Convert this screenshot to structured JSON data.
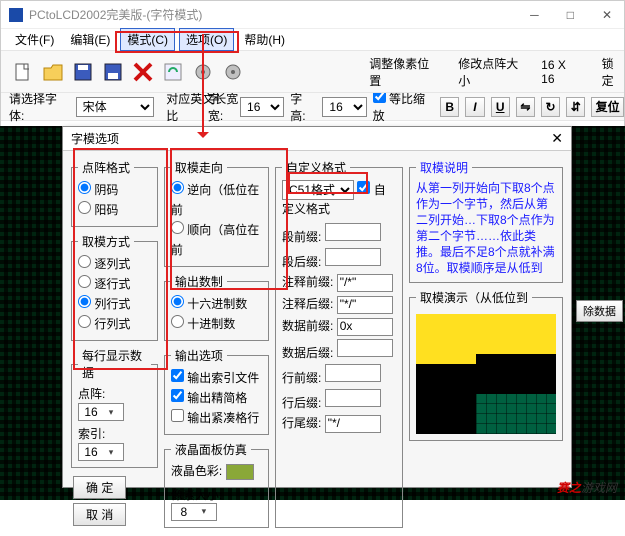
{
  "window": {
    "title": "PCtoLCD2002完美版-(字符模式)",
    "controls": {
      "min": "─",
      "max": "□",
      "close": "✕"
    }
  },
  "menu": {
    "file": "文件(F)",
    "edit": "编辑(E)",
    "mode": "模式(C)",
    "options": "选项(O)",
    "help": "帮助(H)"
  },
  "toolbar": {
    "adjust_label": "调整像素位置",
    "modify_label": "修改点阵大小",
    "size_text": "16 X 16",
    "lock_label": "锁定"
  },
  "row2": {
    "pick_font": "请选择字体:",
    "font_value": "宋体",
    "en_ratio": "对应英文长宽比",
    "width_label": "字宽:",
    "width_value": "16",
    "height_label": "字高:",
    "height_value": "16",
    "scale_label": "等比缩放",
    "restore_label": "复位"
  },
  "dialog": {
    "title": "字模选项",
    "close": "✕",
    "dot_fmt": {
      "legend": "点阵格式",
      "yin": "阴码",
      "yang": "阳码"
    },
    "scan_mode": {
      "legend": "取模方式",
      "col": "逐列式",
      "row": "逐行式",
      "colrow": "列行式",
      "rowcol": "行列式"
    },
    "row_disp": {
      "legend": "每行显示数据",
      "dot_label": "点阵:",
      "dot_val": "16",
      "idx_label": "索引:",
      "idx_val": "16"
    },
    "direction": {
      "legend": "取模走向",
      "rev": "逆向（低位在前",
      "fwd": "顺向（高位在前"
    },
    "radix": {
      "legend": "输出数制",
      "hex": "十六进制数",
      "dec": "十进制数"
    },
    "output": {
      "legend": "输出选项",
      "idxfile": "输出索引文件",
      "compact": "输出精简格",
      "tight": "输出紧凑格行"
    },
    "lcd": {
      "legend": "液晶面板仿真",
      "color_label": "液晶色彩:",
      "px_label": "像素大小:",
      "px_val": "8"
    },
    "custom": {
      "legend": "自定义格式",
      "fmt_value": "C51格式",
      "chk_label": "自定义格式",
      "seg_pre": "段前缀:",
      "seg_suf": "段后缀:",
      "cmt_pre": "注释前缀:",
      "cmt_pre_v": "\"/*\"",
      "cmt_suf": "注释后缀:",
      "cmt_suf_v": "\"*/\"",
      "dat_pre": "数据前缀:",
      "dat_pre_v": "0x",
      "dat_suf": "数据后缀:",
      "ln_pre": "行前缀:",
      "ln_suf": "行后缀:",
      "lntail": "行尾缀:",
      "lntail_v": "\"*/"
    },
    "desc": {
      "legend": "取模说明",
      "body": "从第一列开始向下取8个点作为一个字节，然后从第二列开始…下取8个点作为第二个字节……依此类推。最后不足8个点就补满8位。取模顺序是从低到"
    },
    "preview_legend": "取模演示（从低位到",
    "ok": "确 定",
    "cancel": "取 消"
  },
  "sidebtn": {
    "clear": "除数据"
  },
  "watermark": {
    "a": "赛之",
    "b": "游戏网"
  }
}
